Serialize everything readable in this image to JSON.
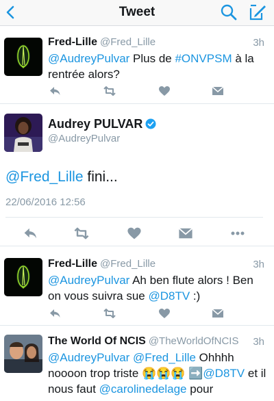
{
  "nav": {
    "title": "Tweet",
    "back_icon": "chevron-left-icon",
    "search_icon": "search-icon",
    "compose_icon": "compose-icon",
    "accent_color": "#1b95e0"
  },
  "replies": [
    {
      "name": "Fred-Lille",
      "handle": "@Fred_Lille",
      "time": "3h",
      "text_parts": [
        "@AudreyPulvar",
        " Plus de ",
        "#ONVPSM",
        " à la rentrée alors?"
      ]
    },
    {
      "name": "Fred-Lille",
      "handle": "@Fred_Lille",
      "time": "3h",
      "text_parts": [
        "@AudreyPulvar",
        " Ah ben flute alors ! Ben on vous suivra sue ",
        "@D8TV",
        " :)"
      ]
    },
    {
      "name": "The World Of NCIS",
      "handle": "@TheWorldOfNCIS",
      "time": "3h",
      "text_parts": [
        "@AudreyPulvar",
        " ",
        "@Fred_Lille",
        " Ohhhh noooon trop triste 😭😭😭 ➡️",
        "@D8TV",
        " et il nous faut ",
        "@carolinedelage",
        " pour"
      ]
    }
  ],
  "main_tweet": {
    "name": "Audrey PULVAR",
    "handle": "@AudreyPulvar",
    "mention": "@Fred_Lille",
    "text": " fini...",
    "date": "22/06/2016 12:56",
    "verified_color": "#1da1f2"
  },
  "action_icons": [
    "reply-icon",
    "retweet-icon",
    "like-icon",
    "dm-icon",
    "more-icon"
  ],
  "icon_color": "#8899a6"
}
